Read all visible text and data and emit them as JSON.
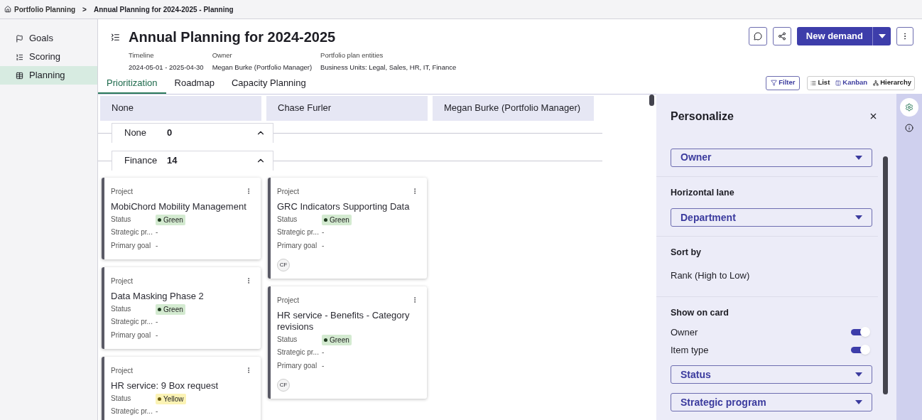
{
  "breadcrumb": {
    "root": "Portfolio Planning",
    "separator": ">",
    "current": "Annual Planning for 2024-2025 - Planning"
  },
  "sidebar": {
    "items": [
      {
        "label": "Goals",
        "selected": false
      },
      {
        "label": "Scoring",
        "selected": false
      },
      {
        "label": "Planning",
        "selected": true
      }
    ]
  },
  "header": {
    "title": "Annual Planning for 2024-2025",
    "meta": [
      {
        "label": "Timeline",
        "value": "2024-05-01 - 2025-04-30"
      },
      {
        "label": "Owner",
        "value": "Megan Burke (Portfolio Manager)"
      },
      {
        "label": "Portfolio plan entities",
        "value": "Business Units: Legal, Sales, HR, IT, Finance"
      }
    ],
    "primary_button": "New demand"
  },
  "tabs": [
    {
      "label": "Prioritization",
      "selected": true
    },
    {
      "label": "Roadmap",
      "selected": false
    },
    {
      "label": "Capacity Planning",
      "selected": false
    }
  ],
  "filter_button": "Filter",
  "views": [
    {
      "label": "List",
      "selected": false
    },
    {
      "label": "Kanban",
      "selected": true
    },
    {
      "label": "Hierarchy",
      "selected": false
    }
  ],
  "board": {
    "columns": [
      "None",
      "Chase Furler",
      "Megan Burke (Portfolio Manager)"
    ],
    "lanes": [
      {
        "name": "None",
        "count": "0",
        "expanded": true
      },
      {
        "name": "Finance",
        "count": "14",
        "expanded": true,
        "cells": [
          [
            {
              "type": "Project",
              "title": "MobiChord Mobility Management",
              "status_label": "Status",
              "status": {
                "label": "Green",
                "kind": "green"
              },
              "strategic_program": {
                "label": "Strategic pr...",
                "value": "-"
              },
              "primary_goal": {
                "label": "Primary goal",
                "value": "-"
              }
            },
            {
              "type": "Project",
              "title": "Data Masking Phase 2",
              "status_label": "Status",
              "status": {
                "label": "Green",
                "kind": "green"
              },
              "strategic_program": {
                "label": "Strategic pr...",
                "value": "-"
              },
              "primary_goal": {
                "label": "Primary goal",
                "value": "-"
              }
            },
            {
              "type": "Project",
              "title": "HR service: 9 Box request",
              "status_label": "Status",
              "status": {
                "label": "Yellow",
                "kind": "yellow"
              },
              "strategic_program": {
                "label": "Strategic pr...",
                "value": "-"
              }
            }
          ],
          [
            {
              "type": "Project",
              "title": "GRC Indicators Supporting Data",
              "status_label": "Status",
              "status": {
                "label": "Green",
                "kind": "green"
              },
              "strategic_program": {
                "label": "Strategic pr...",
                "value": "-"
              },
              "primary_goal": {
                "label": "Primary goal",
                "value": "-"
              },
              "avatar": "CF"
            },
            {
              "type": "Project",
              "title": "HR service - Benefits - Category revisions",
              "status_label": "Status",
              "status": {
                "label": "Green",
                "kind": "green"
              },
              "strategic_program": {
                "label": "Strategic pr...",
                "value": "-"
              },
              "primary_goal": {
                "label": "Primary goal",
                "value": "-"
              },
              "avatar": "CF"
            }
          ]
        ]
      }
    ]
  },
  "personalize": {
    "title": "Personalize",
    "vertical_lane_value": "Owner",
    "horizontal_lane": {
      "label": "Horizontal lane",
      "value": "Department"
    },
    "sort": {
      "label": "Sort by",
      "value": "Rank (High to Low)"
    },
    "show_on_card": {
      "label": "Show on card",
      "toggles": [
        {
          "label": "Owner",
          "on": true
        },
        {
          "label": "Item type",
          "on": true
        }
      ],
      "selects": [
        "Status",
        "Strategic program"
      ]
    }
  }
}
